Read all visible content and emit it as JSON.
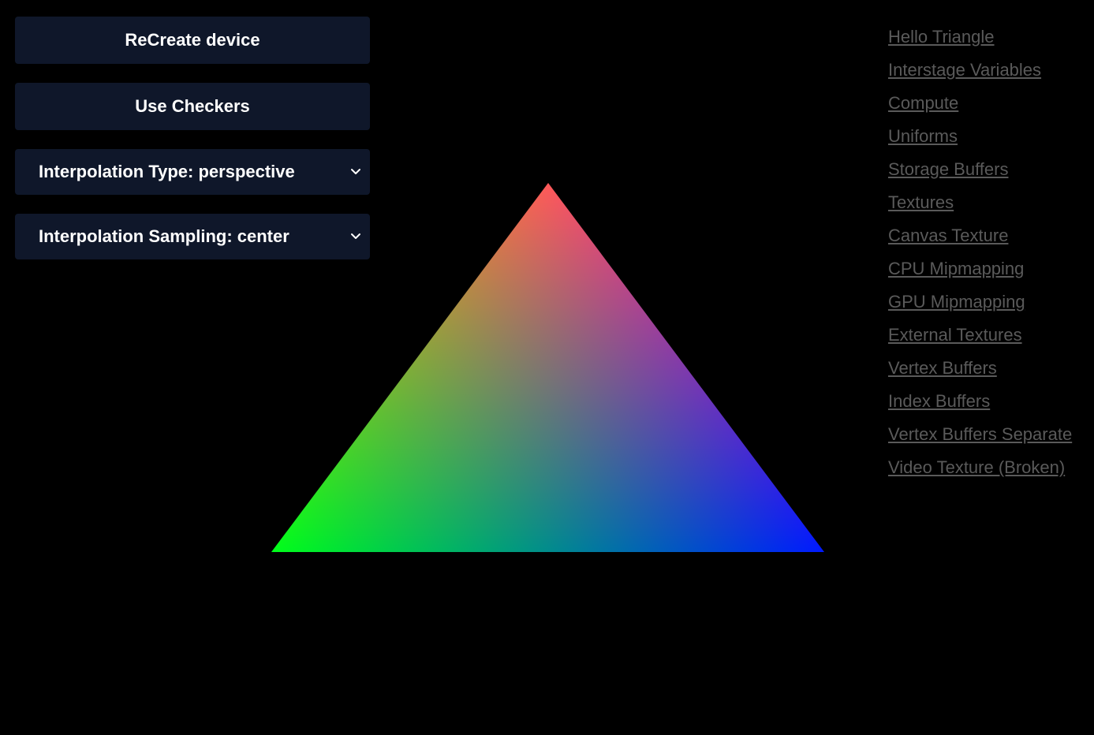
{
  "controls": {
    "recreate_label": "ReCreate device",
    "checkers_label": "Use Checkers",
    "interp_type_label": "Interpolation Type: perspective",
    "interp_sampling_label": "Interpolation Sampling: center"
  },
  "nav": {
    "links": [
      "Hello Triangle",
      "Interstage Variables",
      "Compute",
      "Uniforms",
      "Storage Buffers",
      "Textures",
      "Canvas Texture",
      "CPU Mipmapping",
      "GPU Mipmapping",
      "External Textures",
      "Vertex Buffers",
      "Index Buffers",
      "Vertex Buffers Separate",
      "Video Texture (Broken)"
    ]
  },
  "triangle": {
    "vertex_colors": {
      "top": "#ff0000",
      "bottom_left": "#00ff00",
      "bottom_right": "#0000ff"
    }
  },
  "colors": {
    "background": "#000000",
    "button_bg": "#0f172a",
    "link": "#5a5a5a"
  }
}
